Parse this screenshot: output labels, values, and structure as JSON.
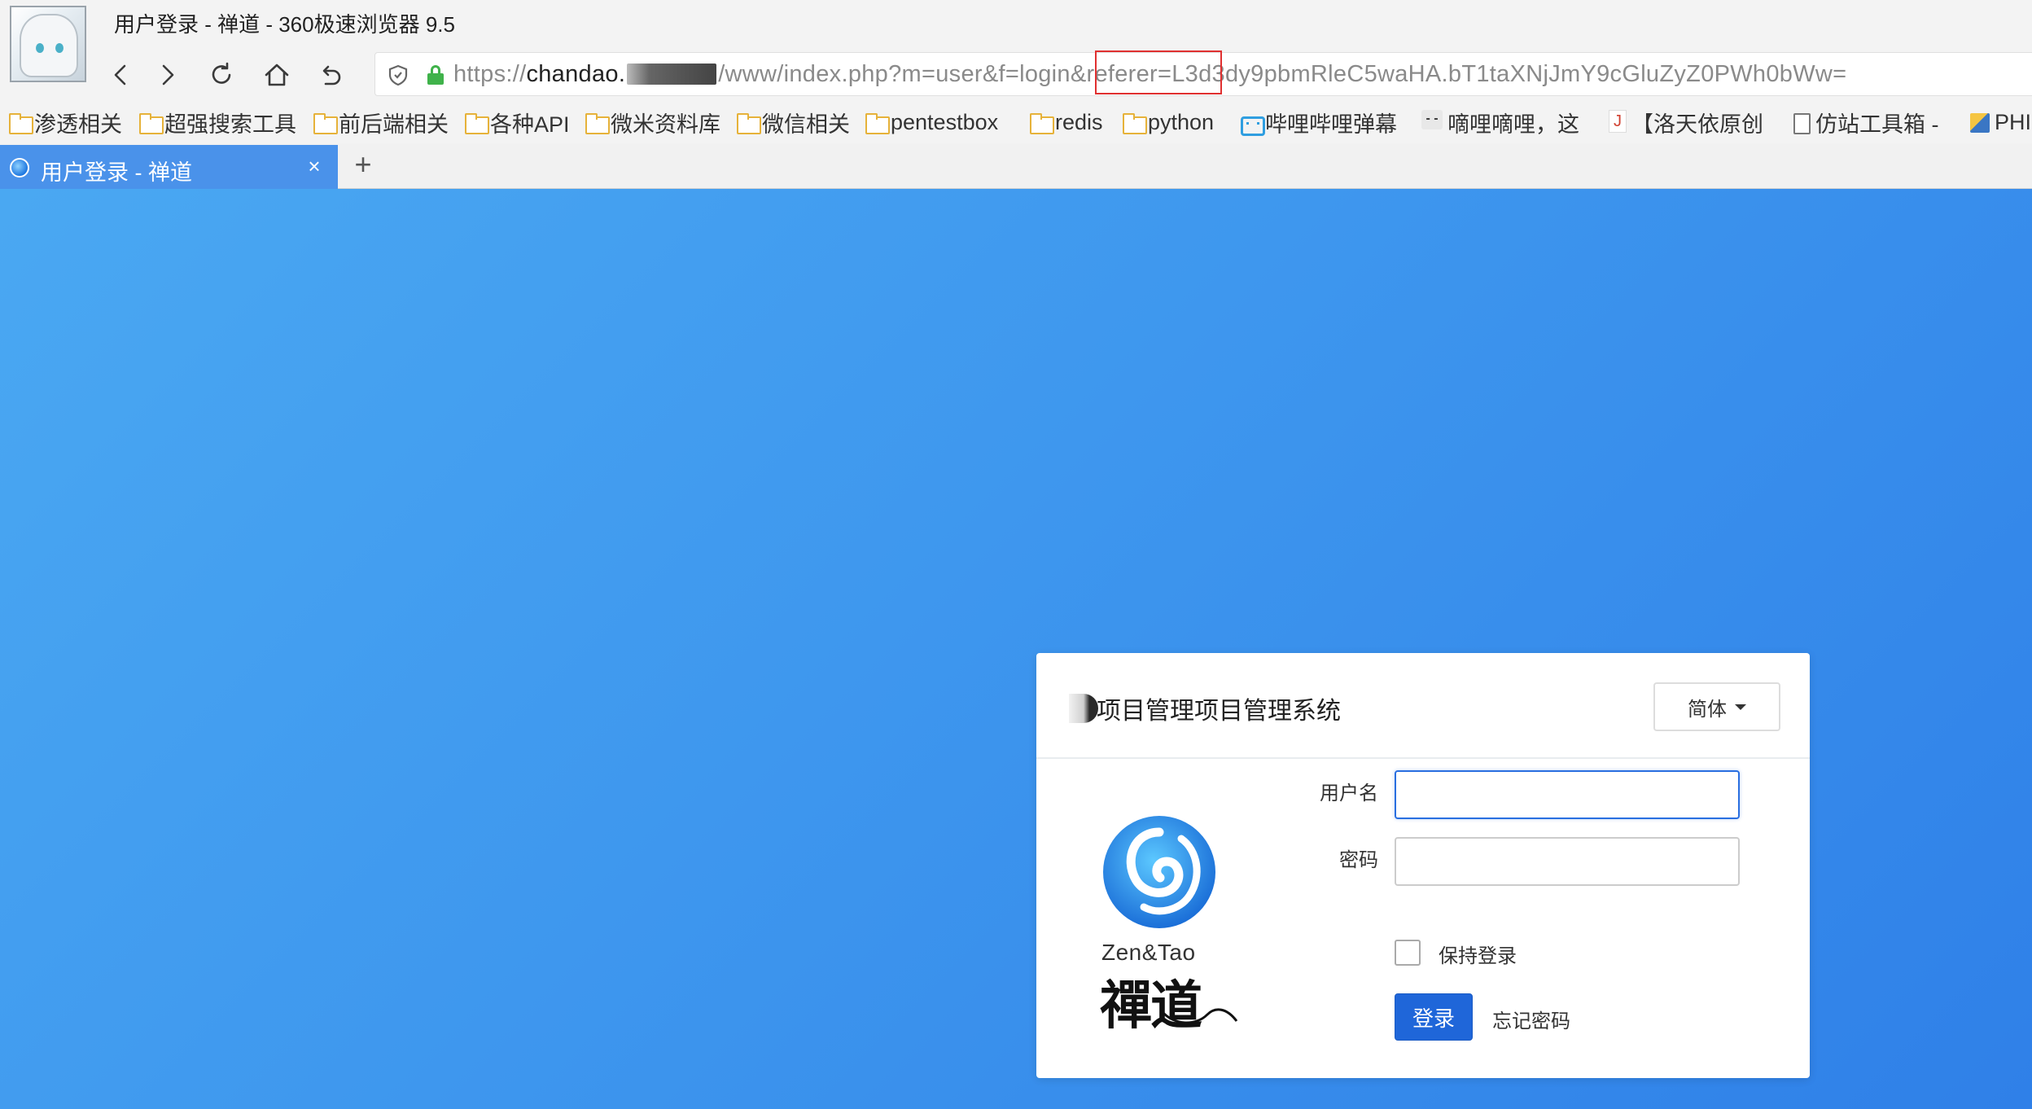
{
  "window": {
    "title": "用户登录 - 禅道 - 360极速浏览器 9.5"
  },
  "navigation": {
    "back_icon": "chevron-left-icon",
    "forward_icon": "chevron-right-icon",
    "reload_icon": "reload-icon",
    "home_icon": "home-icon",
    "undo_icon": "undo-icon"
  },
  "address_bar": {
    "scheme": "https://",
    "host": "chandao.",
    "path": "/www/index.php?m=user&f=login&referer=L3d3dy9pbmRleC5waHA.bT1taXNjJmY9cGluZyZ0PWh0bWw="
  },
  "bookmarks": [
    {
      "label": "渗透相关",
      "icon": "folder-icon"
    },
    {
      "label": "超强搜索工具",
      "icon": "folder-icon"
    },
    {
      "label": "前后端相关",
      "icon": "folder-icon"
    },
    {
      "label": "各种API",
      "icon": "folder-icon"
    },
    {
      "label": "微米资料库",
      "icon": "folder-icon"
    },
    {
      "label": "微信相关",
      "icon": "folder-icon"
    },
    {
      "label": "pentestbox",
      "icon": "folder-icon"
    },
    {
      "label": "redis",
      "icon": "folder-icon"
    },
    {
      "label": "python",
      "icon": "folder-icon"
    },
    {
      "label": "哔哩哔哩弹幕",
      "icon": "bilibili-icon"
    },
    {
      "label": "嘀哩嘀哩，这",
      "icon": "face-icon"
    },
    {
      "label": "【洛天依原创",
      "icon": "j-icon"
    },
    {
      "label": "仿站工具箱 -",
      "icon": "document-icon"
    },
    {
      "label": "PHI",
      "icon": "php-icon"
    }
  ],
  "tabs": [
    {
      "label": "用户登录 - 禅道",
      "active": true
    }
  ],
  "new_tab_label": "+",
  "tab_close_label": "×",
  "login": {
    "system_title": "项目管理项目管理系统",
    "language_label": "简体",
    "username_label": "用户名",
    "username_value": "",
    "password_label": "密码",
    "password_value": "",
    "remember_label": "保持登录",
    "remember_checked": false,
    "submit_label": "登录",
    "forgot_label": "忘记密码",
    "logo_text_en": "Zen&Tao",
    "logo_text_cn": "禪道"
  },
  "colors": {
    "accent": "#1f66d9",
    "tab_active": "#4a92ea",
    "page_gradient_start": "#4aa8f2",
    "page_gradient_end": "#2f80e8",
    "url_highlight": "#e03030",
    "lock_green": "#3fb24a"
  }
}
